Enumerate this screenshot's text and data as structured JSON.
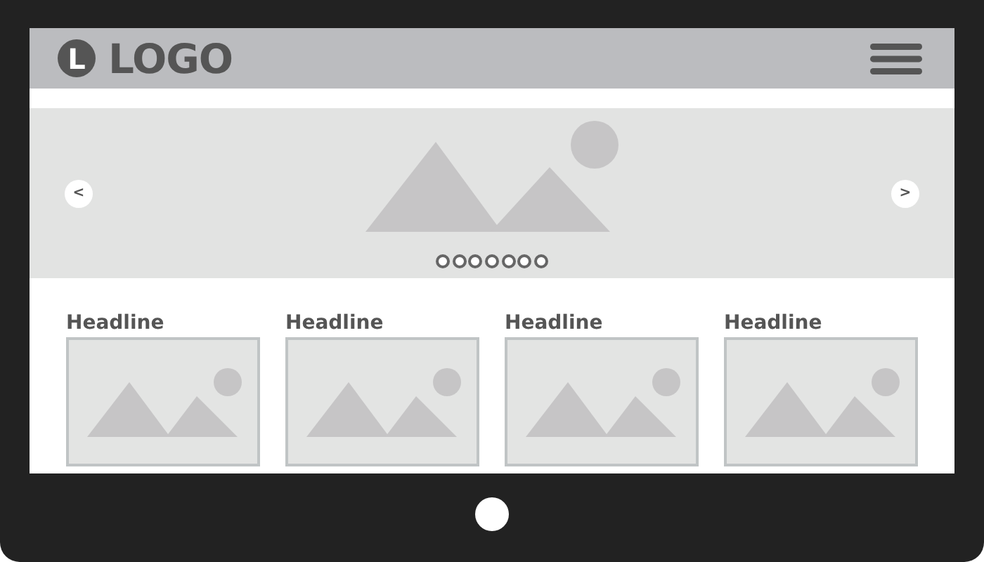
{
  "header": {
    "logo_mark": "L",
    "logo_text": "LOGO"
  },
  "carousel": {
    "prev": "<",
    "next": ">",
    "dots": [
      {
        "selected": false
      },
      {
        "selected": false
      },
      {
        "selected": false
      },
      {
        "selected": false
      },
      {
        "selected": false
      },
      {
        "selected": false
      },
      {
        "selected": false
      }
    ]
  },
  "cards": [
    {
      "headline": "Headline"
    },
    {
      "headline": "Headline"
    },
    {
      "headline": "Headline"
    },
    {
      "headline": "Headline"
    }
  ]
}
